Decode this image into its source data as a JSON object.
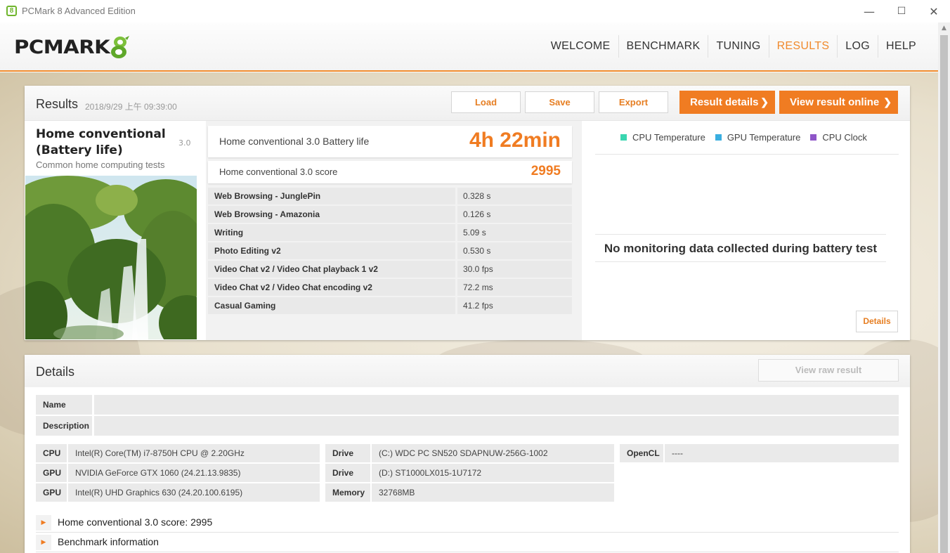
{
  "window": {
    "title": "PCMark 8 Advanced Edition",
    "app_icon": "8",
    "minimize": "—",
    "maximize": "☐",
    "close": "✕"
  },
  "logo": {
    "text": "PCMARK",
    "mark": "8"
  },
  "nav": {
    "items": [
      "WELCOME",
      "BENCHMARK",
      "TUNING",
      "RESULTS",
      "LOG",
      "HELP"
    ],
    "active": "RESULTS"
  },
  "results": {
    "title": "Results",
    "date": "2018/9/29 上午 09:39:00",
    "buttons": {
      "load": "Load",
      "save": "Save",
      "export": "Export"
    },
    "result_details": "Result details",
    "view_online": "View result online",
    "test": {
      "name_line1": "Home conventional",
      "name_line2": "(Battery life)",
      "version": "3.0",
      "subtitle": "Common home computing tests"
    },
    "battery_label": "Home conventional 3.0 Battery life",
    "battery_value": "4h 22min",
    "score_label": "Home conventional 3.0 score",
    "score_value": "2995",
    "subtests": [
      {
        "name": "Web Browsing - JunglePin",
        "value": "0.328 s"
      },
      {
        "name": "Web Browsing - Amazonia",
        "value": "0.126 s"
      },
      {
        "name": "Writing",
        "value": "5.09 s"
      },
      {
        "name": "Photo Editing v2",
        "value": "0.530 s"
      },
      {
        "name": "Video Chat v2 / Video Chat playback 1 v2",
        "value": "30.0 fps"
      },
      {
        "name": "Video Chat v2 / Video Chat encoding v2",
        "value": "72.2 ms"
      },
      {
        "name": "Casual Gaming",
        "value": "41.2 fps"
      }
    ],
    "legend": [
      {
        "label": "CPU Temperature",
        "color": "#3ad6b0"
      },
      {
        "label": "GPU Temperature",
        "color": "#3aaee0"
      },
      {
        "label": "CPU Clock",
        "color": "#8e55c8"
      }
    ],
    "no_monitoring": "No monitoring data collected during battery test",
    "details_button": "Details"
  },
  "details": {
    "title": "Details",
    "view_raw": "View raw result",
    "name_label": "Name",
    "name_value": "",
    "description_label": "Description",
    "description_value": "",
    "hardware": {
      "cpu_label": "CPU",
      "cpu": "Intel(R) Core(TM) i7-8750H CPU @ 2.20GHz",
      "gpu1_label": "GPU",
      "gpu1": "NVIDIA GeForce GTX 1060 (24.21.13.9835)",
      "gpu2_label": "GPU",
      "gpu2": "Intel(R) UHD Graphics 630 (24.20.100.6195)",
      "drive1_label": "Drive",
      "drive1": "(C:) WDC PC SN520 SDAPNUW-256G-1002",
      "drive2_label": "Drive",
      "drive2": "(D:) ST1000LX015-1U7172",
      "memory_label": "Memory",
      "memory": "32768MB",
      "opencl_label": "OpenCL",
      "opencl": "----"
    },
    "expanders": [
      "Home conventional 3.0 score: 2995",
      "Benchmark information"
    ]
  },
  "colors": {
    "accent": "#f07c22",
    "logo_green": "#6fb52c"
  }
}
